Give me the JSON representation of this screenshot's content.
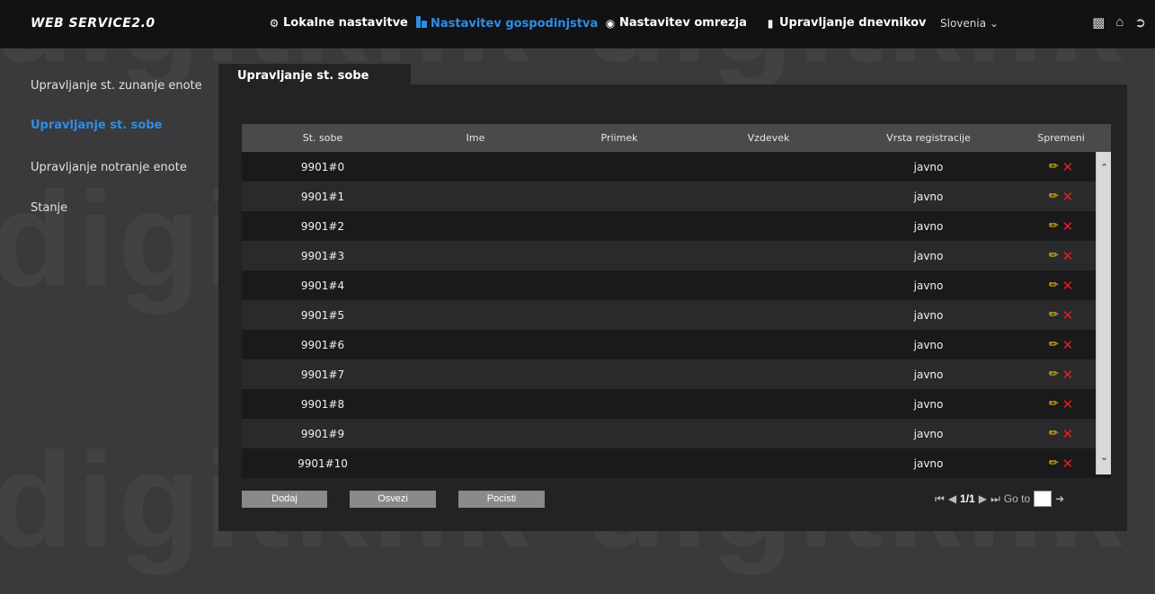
{
  "header": {
    "logo": "WEB SERVICE2.0",
    "nav": [
      {
        "icon": "gear-icon",
        "label": "Lokalne nastavitve"
      },
      {
        "icon": "building-icon",
        "label": "Nastavitev gospodinjstva"
      },
      {
        "icon": "globe-icon",
        "label": "Nastavitev omrezja"
      },
      {
        "icon": "log-icon",
        "label": "Upravljanje dnevnikov"
      }
    ],
    "language": "Slovenia",
    "icons": [
      "user-icon",
      "home-icon",
      "logout-icon"
    ]
  },
  "sidebar": {
    "items": [
      {
        "label": "Upravljanje st. zunanje enote"
      },
      {
        "label": "Upravljanje st. sobe"
      },
      {
        "label": "Upravljanje notranje enote"
      },
      {
        "label": "Stanje"
      }
    ]
  },
  "main": {
    "tab": "Upravljanje st. sobe",
    "columns": [
      "St. sobe",
      "Ime",
      "Priimek",
      "Vzdevek",
      "Vrsta registracije",
      "Spremeni"
    ],
    "rows": [
      {
        "room": "9901#0",
        "name": "",
        "surname": "",
        "nickname": "",
        "registration": "javno"
      },
      {
        "room": "9901#1",
        "name": "",
        "surname": "",
        "nickname": "",
        "registration": "javno"
      },
      {
        "room": "9901#2",
        "name": "",
        "surname": "",
        "nickname": "",
        "registration": "javno"
      },
      {
        "room": "9901#3",
        "name": "",
        "surname": "",
        "nickname": "",
        "registration": "javno"
      },
      {
        "room": "9901#4",
        "name": "",
        "surname": "",
        "nickname": "",
        "registration": "javno"
      },
      {
        "room": "9901#5",
        "name": "",
        "surname": "",
        "nickname": "",
        "registration": "javno"
      },
      {
        "room": "9901#6",
        "name": "",
        "surname": "",
        "nickname": "",
        "registration": "javno"
      },
      {
        "room": "9901#7",
        "name": "",
        "surname": "",
        "nickname": "",
        "registration": "javno"
      },
      {
        "room": "9901#8",
        "name": "",
        "surname": "",
        "nickname": "",
        "registration": "javno"
      },
      {
        "room": "9901#9",
        "name": "",
        "surname": "",
        "nickname": "",
        "registration": "javno"
      },
      {
        "room": "9901#10",
        "name": "",
        "surname": "",
        "nickname": "",
        "registration": "javno"
      }
    ],
    "buttons": {
      "add": "Dodaj",
      "refresh": "Osvezi",
      "clear": "Pocisti"
    },
    "pager": {
      "page": "1/1",
      "goto_label": "Go to"
    }
  },
  "watermark": "digitklik",
  "colors": {
    "accent": "#2f8de4",
    "edit": "#f5d000",
    "delete": "#e02020"
  }
}
